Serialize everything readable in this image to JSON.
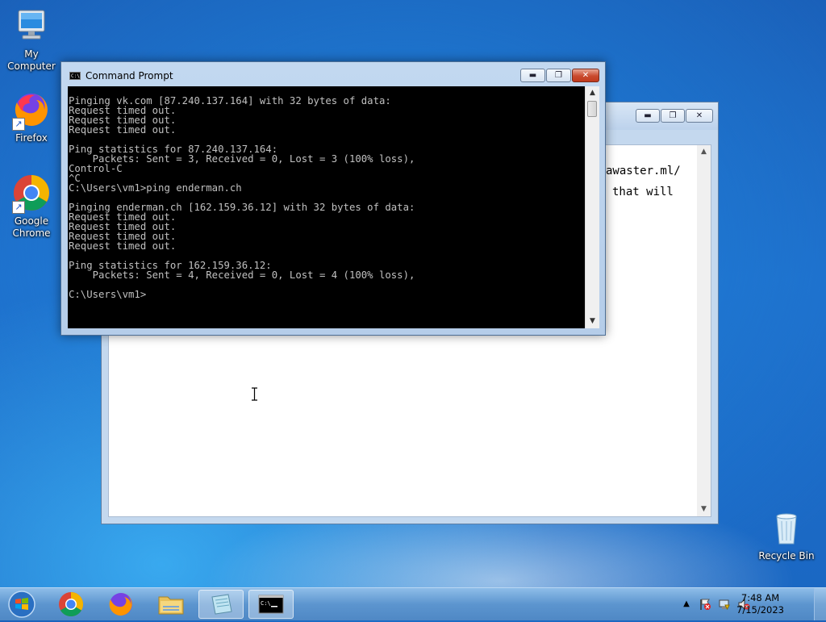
{
  "desktop": {
    "icons": [
      {
        "label": "My Computer"
      },
      {
        "label": "Firefox"
      },
      {
        "label": "Google Chrome"
      },
      {
        "label": "Recycle Bin"
      }
    ]
  },
  "notepad": {
    "text_line1": "awaster.ml/",
    "text_line2": "that will"
  },
  "cmd": {
    "title": "Command Prompt",
    "output": [
      "Pinging vk.com [87.240.137.164] with 32 bytes of data:",
      "Request timed out.",
      "Request timed out.",
      "Request timed out.",
      "",
      "Ping statistics for 87.240.137.164:",
      "    Packets: Sent = 3, Received = 0, Lost = 3 (100% loss),",
      "Control-C",
      "^C",
      "C:\\Users\\vm1>ping enderman.ch",
      "",
      "Pinging enderman.ch [162.159.36.12] with 32 bytes of data:",
      "Request timed out.",
      "Request timed out.",
      "Request timed out.",
      "Request timed out.",
      "",
      "Ping statistics for 162.159.36.12:",
      "    Packets: Sent = 4, Received = 0, Lost = 4 (100% loss),",
      "",
      "C:\\Users\\vm1>"
    ]
  },
  "taskbar": {
    "clock_time": "7:48 AM",
    "clock_date": "7/15/2023",
    "pinned": [
      "start-button",
      "chrome-icon",
      "firefox-icon",
      "explorer-icon",
      "notepad-icon",
      "cmd-icon"
    ]
  },
  "colors": {
    "console_bg": "#000000",
    "console_fg": "#c0c0c0",
    "close_button": "#c94a2e"
  }
}
